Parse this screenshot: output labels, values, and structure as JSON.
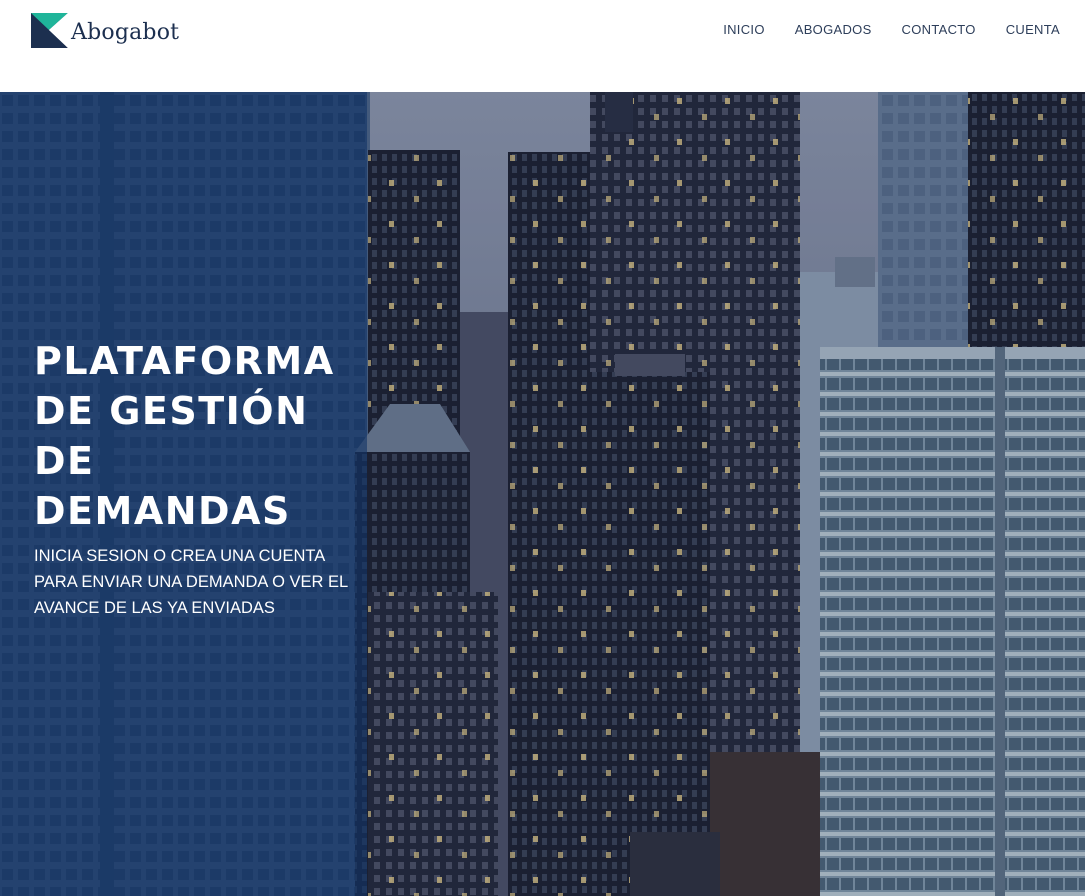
{
  "brand": {
    "name": "Abogabot",
    "colors": {
      "teal": "#1fb59a",
      "navy": "#1c2f4f"
    }
  },
  "nav": {
    "items": [
      {
        "label": "INICIO"
      },
      {
        "label": "ABOGADOS"
      },
      {
        "label": "CONTACTO"
      },
      {
        "label": "CUENTA"
      }
    ]
  },
  "hero": {
    "title": "PLATAFORMA DE GESTIÓN DE DEMANDAS",
    "subtitle": "INICIA SESION O CREA UNA CUENTA PARA ENVIAR UNA DEMANDA O VER EL AVANCE DE LAS YA ENVIADAS",
    "background": "city-skyscrapers-photo",
    "overlay_color": "#123468"
  }
}
